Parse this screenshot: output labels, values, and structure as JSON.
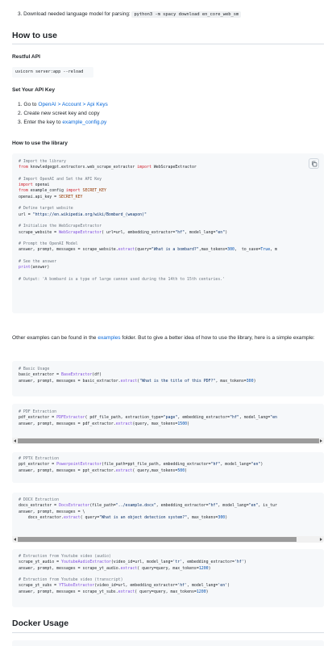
{
  "install_step": {
    "number": "3.",
    "text": "Download needed language model for parsing:",
    "command": "python3 -m spacy download en_core_web_sm"
  },
  "how_to_use": {
    "heading": "How to use",
    "restful_heading": "Restful API",
    "restful_command": "uvicorn server:app --reload",
    "api_key_heading": "Set Your API Key",
    "steps": [
      {
        "num": "1.",
        "prefix": "Go to ",
        "links": [
          "OpenAI",
          "Account",
          "Api Keys"
        ],
        "sep": " > "
      },
      {
        "num": "2.",
        "text": "Create new screet key and copy"
      },
      {
        "num": "3.",
        "prefix": "Enter the key to ",
        "link": "example_config.py"
      }
    ],
    "library_heading": "How to use the library",
    "library_code": [
      [
        {
          "t": "# Import the library",
          "c": "c"
        }
      ],
      [
        {
          "t": "from",
          "c": "k"
        },
        {
          "t": " knowledgegpt.extractors.web_scrape_extractor "
        },
        {
          "t": "import",
          "c": "k"
        },
        {
          "t": " WebScrapeExtractor"
        }
      ],
      [],
      [
        {
          "t": "# Import OpenAI and Set the API Key",
          "c": "c"
        }
      ],
      [
        {
          "t": "import",
          "c": "k"
        },
        {
          "t": " openai"
        }
      ],
      [
        {
          "t": "from",
          "c": "k"
        },
        {
          "t": " example_config "
        },
        {
          "t": "import",
          "c": "k"
        },
        {
          "t": " SECRET_KEY",
          "c": "v"
        }
      ],
      [
        {
          "t": "openai.api_key = "
        },
        {
          "t": "SECRET_KEY",
          "c": "v"
        }
      ],
      [],
      [
        {
          "t": "# Define target website",
          "c": "c"
        }
      ],
      [
        {
          "t": "url = "
        },
        {
          "t": "\"https://en.wikipedia.org/wiki/Bombard_(weapon)\"",
          "c": "s"
        }
      ],
      [],
      [
        {
          "t": "# Initialize the WebScrapeExtractor",
          "c": "c"
        }
      ],
      [
        {
          "t": "scrape_website = "
        },
        {
          "t": "WebScrapeExtractor",
          "c": "f"
        },
        {
          "t": "( url=url, embedding_extractor="
        },
        {
          "t": "\"hf\"",
          "c": "s"
        },
        {
          "t": ", model_lang="
        },
        {
          "t": "\"en\"",
          "c": "s"
        },
        {
          "t": ")"
        }
      ],
      [],
      [
        {
          "t": "# Prompt the OpenAI Model",
          "c": "c"
        }
      ],
      [
        {
          "t": "answer, prompt, messages = scrape_website."
        },
        {
          "t": "extract",
          "c": "f"
        },
        {
          "t": "(query="
        },
        {
          "t": "\"What is a bombard?\"",
          "c": "s"
        },
        {
          "t": ",max_tokens="
        },
        {
          "t": "300",
          "c": "b"
        },
        {
          "t": ",  to_save="
        },
        {
          "t": "True",
          "c": "b"
        },
        {
          "t": ", m"
        }
      ],
      [],
      [
        {
          "t": "# See the answer",
          "c": "c"
        }
      ],
      [
        {
          "t": "print",
          "c": "f"
        },
        {
          "t": "(answer)"
        }
      ],
      [],
      [
        {
          "t": "# Output: 'A bombard is a type of large cannon used during the 14th to 15th centuries.'",
          "c": "c"
        }
      ]
    ],
    "other_examples": {
      "prefix": "Other examples can be found in the ",
      "link": "examples",
      "suffix": " folder. But to give a better idea of how to use the library, here is a simple example:"
    },
    "example_blocks": [
      [
        [
          {
            "t": "# Basic Usage",
            "c": "c"
          }
        ],
        [
          {
            "t": "basic_extractor = "
          },
          {
            "t": "BaseExtractor",
            "c": "f"
          },
          {
            "t": "(df)"
          }
        ],
        [
          {
            "t": "answer, prompt, messages = basic_extractor."
          },
          {
            "t": "extract",
            "c": "f"
          },
          {
            "t": "("
          },
          {
            "t": "\"What is the title of this PDF?\"",
            "c": "s"
          },
          {
            "t": ", max_tokens="
          },
          {
            "t": "300",
            "c": "b"
          },
          {
            "t": ")"
          }
        ]
      ],
      [
        [
          {
            "t": "# PDF Extraction",
            "c": "c"
          }
        ],
        [
          {
            "t": "pdf_extractor = "
          },
          {
            "t": "PDFExtractor",
            "c": "f"
          },
          {
            "t": "( pdf_file_path, extraction_type="
          },
          {
            "t": "\"page\"",
            "c": "s"
          },
          {
            "t": ", embedding_extractor="
          },
          {
            "t": "\"hf\"",
            "c": "s"
          },
          {
            "t": ", model_lang="
          },
          {
            "t": "\"en",
            "c": "s"
          }
        ],
        [
          {
            "t": "answer, prompt, messages = pdf_extractor."
          },
          {
            "t": "extract",
            "c": "f"
          },
          {
            "t": "(query, max_tokens="
          },
          {
            "t": "1500",
            "c": "b"
          },
          {
            "t": ")"
          }
        ]
      ],
      [
        [
          {
            "t": "# PPTX Extraction",
            "c": "c"
          }
        ],
        [
          {
            "t": "ppt_extractor = "
          },
          {
            "t": "PowerpointExtractor",
            "c": "f"
          },
          {
            "t": "(file_path=ppt_file_path, embedding_extractor="
          },
          {
            "t": "\"hf\"",
            "c": "s"
          },
          {
            "t": ", model_lang="
          },
          {
            "t": "\"en\"",
            "c": "s"
          },
          {
            "t": ")"
          }
        ],
        [
          {
            "t": "answer, prompt, messages = ppt_extractor."
          },
          {
            "t": "extract",
            "c": "f"
          },
          {
            "t": "( query,max_tokens="
          },
          {
            "t": "500",
            "c": "b"
          },
          {
            "t": ")"
          }
        ]
      ],
      [
        [
          {
            "t": "# DOCX Extraction",
            "c": "c"
          }
        ],
        [
          {
            "t": "docs_extractor = "
          },
          {
            "t": "DocsExtractor",
            "c": "f"
          },
          {
            "t": "(file_path="
          },
          {
            "t": "\"../example.docx\"",
            "c": "s"
          },
          {
            "t": ", embedding_extractor="
          },
          {
            "t": "\"hf\"",
            "c": "s"
          },
          {
            "t": ", model_lang="
          },
          {
            "t": "\"en\"",
            "c": "s"
          },
          {
            "t": ", is_tur"
          }
        ],
        [
          {
            "t": "answer, prompt, messages = \\"
          }
        ],
        [
          {
            "t": "    docs_extractor."
          },
          {
            "t": "extract",
            "c": "f"
          },
          {
            "t": "( query="
          },
          {
            "t": "\"What is an object detection system?\"",
            "c": "s"
          },
          {
            "t": ", max_tokens="
          },
          {
            "t": "300",
            "c": "b"
          },
          {
            "t": ")"
          }
        ]
      ],
      [
        [
          {
            "t": "# Extraction from Youtube video (audio)",
            "c": "c"
          }
        ],
        [
          {
            "t": "scrape_yt_audio = "
          },
          {
            "t": "YoutubeAudioExtractor",
            "c": "f"
          },
          {
            "t": "(video_id=url, model_lang="
          },
          {
            "t": "'tr'",
            "c": "s"
          },
          {
            "t": ", embedding_extractor="
          },
          {
            "t": "'hf'",
            "c": "s"
          },
          {
            "t": ")"
          }
        ],
        [
          {
            "t": "answer, prompt, messages = scrape_yt_audio."
          },
          {
            "t": "extract",
            "c": "f"
          },
          {
            "t": "( query=query, max_tokens="
          },
          {
            "t": "1200",
            "c": "b"
          },
          {
            "t": ")"
          }
        ],
        [],
        [
          {
            "t": "# Extraction from Youtube video (transcript)",
            "c": "c"
          }
        ],
        [
          {
            "t": "scrape_yt_subs = "
          },
          {
            "t": "YTSubsExtractor",
            "c": "f"
          },
          {
            "t": "(video_id=url, embedding_extractor="
          },
          {
            "t": "'hf'",
            "c": "s"
          },
          {
            "t": ", model_lang="
          },
          {
            "t": "'en'",
            "c": "s"
          },
          {
            "t": ")"
          }
        ],
        [
          {
            "t": "answer, prompt, messages = scrape_yt_subs."
          },
          {
            "t": "extract",
            "c": "f"
          },
          {
            "t": "( query=query, max_tokens="
          },
          {
            "t": "1200",
            "c": "b"
          },
          {
            "t": ")"
          }
        ]
      ]
    ]
  },
  "docker": {
    "heading": "Docker Usage"
  },
  "colors": {
    "link": "#0969da",
    "code_bg": "#f6f8fa",
    "comment": "#6e7781",
    "keyword": "#cf222e",
    "string": "#0a3069",
    "function": "#8250df"
  }
}
